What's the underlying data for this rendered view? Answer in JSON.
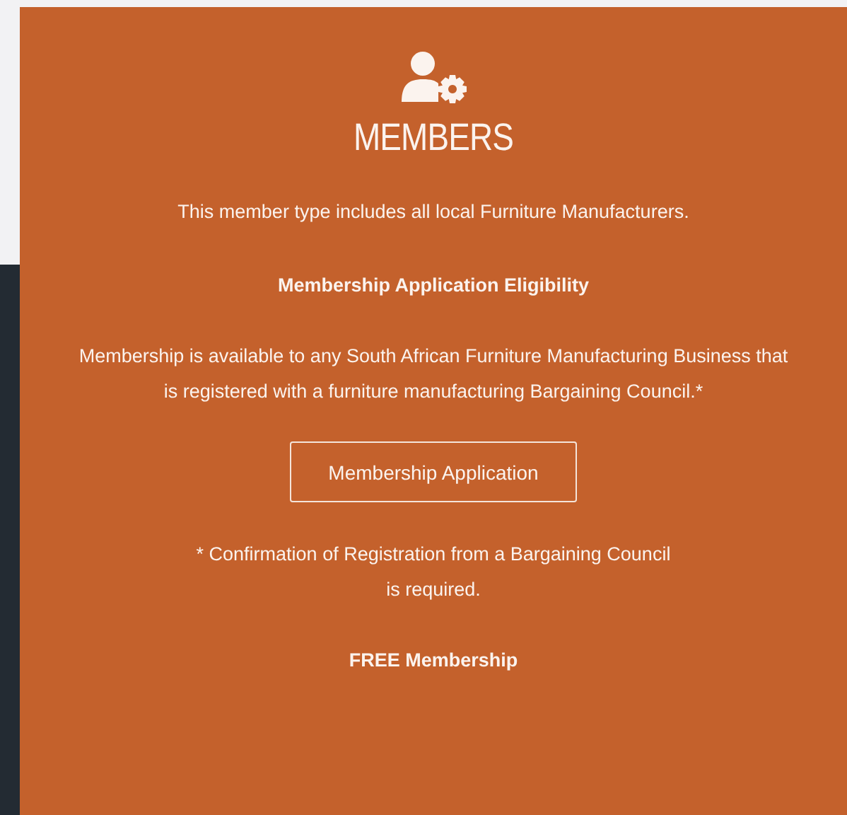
{
  "panel": {
    "title": "MEMBERS",
    "intro": "This member type includes all local Furniture Manufacturers.",
    "heading": "Membership Application Eligibility",
    "body": "Membership is available to any South African Furniture Manufacturing Business that is registered with a furniture manufacturing Bargaining Council.*",
    "button": "Membership Application",
    "note": [
      "* Confirmation of Registration from a Bargaining Council",
      "is required."
    ],
    "footer": "FREE Membership"
  }
}
